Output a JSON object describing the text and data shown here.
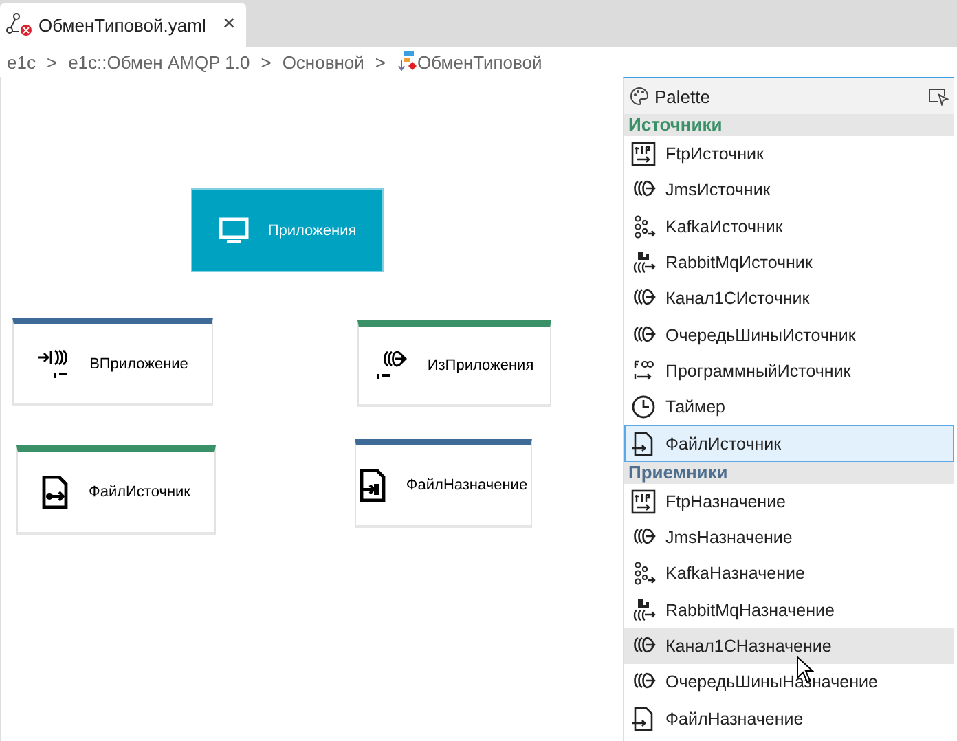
{
  "tab": {
    "title": "ОбменТиповой.yaml",
    "close": "×",
    "selected": true
  },
  "breadcrumb": [
    "e1c",
    "e1c::Обмен AMQP 1.0",
    "Основной",
    "ОбменТиповой"
  ],
  "breadcrumb_separator": ">",
  "nodes": [
    {
      "kind": "group",
      "label": "Приложения"
    },
    {
      "kind": "endpoint",
      "label": "ВПриложение",
      "color": "#3d6a96"
    },
    {
      "kind": "endpoint",
      "label": "ИзПриложения",
      "color": "#3a9168"
    },
    {
      "kind": "endpoint",
      "label": "ФайлИсточник",
      "color": "#3a9168"
    },
    {
      "kind": "endpoint",
      "label": "ФайлНазначение",
      "color": "#3d6a96"
    }
  ],
  "palette": {
    "title": "Palette",
    "sections": [
      {
        "title": "Источники",
        "color": "#3a9168",
        "items": [
          {
            "label": "FtpИсточник",
            "kind": "ftp",
            "selected": false,
            "hovered": false
          },
          {
            "label": "JmsИсточник",
            "kind": "queue",
            "selected": false,
            "hovered": false
          },
          {
            "label": "KafkaИсточник",
            "kind": "kafka",
            "selected": false,
            "hovered": false
          },
          {
            "label": "RabbitMqИсточник",
            "kind": "rabbit",
            "selected": false,
            "hovered": false
          },
          {
            "label": "Канал1СИсточник",
            "kind": "queue",
            "selected": false,
            "hovered": false
          },
          {
            "label": "ОчередьШиныИсточник",
            "kind": "queue",
            "selected": false,
            "hovered": false
          },
          {
            "label": "ПрограммныйИсточник",
            "kind": "program",
            "selected": false,
            "hovered": false
          },
          {
            "label": "Таймер",
            "kind": "timer",
            "selected": false,
            "hovered": false
          },
          {
            "label": "ФайлИсточник",
            "kind": "file",
            "selected": true,
            "hovered": false
          }
        ]
      },
      {
        "title": "Приемники",
        "color": "#4f6f8f",
        "items": [
          {
            "label": "FtpНазначение",
            "kind": "ftp",
            "selected": false,
            "hovered": false
          },
          {
            "label": "JmsНазначение",
            "kind": "queue",
            "selected": false,
            "hovered": false
          },
          {
            "label": "KafkaНазначение",
            "kind": "kafka",
            "selected": false,
            "hovered": false
          },
          {
            "label": "RabbitMqНазначение",
            "kind": "rabbit",
            "selected": false,
            "hovered": false
          },
          {
            "label": "Канал1СНазначение",
            "kind": "queue",
            "selected": false,
            "hovered": true
          },
          {
            "label": "ОчередьШиныНазначение",
            "kind": "queue",
            "selected": false,
            "hovered": false
          },
          {
            "label": "ФайлНазначение",
            "kind": "file",
            "selected": false,
            "hovered": false
          }
        ]
      }
    ]
  }
}
